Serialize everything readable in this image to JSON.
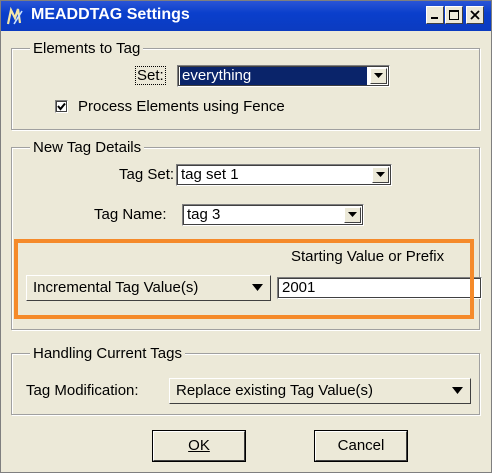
{
  "window": {
    "title": "MEADDTAG Settings",
    "controls": {
      "minimize": "_",
      "maximize": "□",
      "close": "×"
    }
  },
  "elements_to_tag": {
    "legend": "Elements to Tag",
    "set_label": "Set:",
    "set_value": "everything",
    "fence_checkbox_label": "Process Elements using Fence",
    "fence_checked": true
  },
  "new_tag_details": {
    "legend": "New Tag Details",
    "tag_set_label": "Tag Set:",
    "tag_set_value": "tag set 1",
    "tag_name_label": "Tag Name:",
    "tag_name_value": "tag 3",
    "starting_value_label": "Starting Value or Prefix",
    "mode_value": "Incremental Tag Value(s)",
    "starting_value": "2001"
  },
  "handling_current_tags": {
    "legend": "Handling Current Tags",
    "modification_label": "Tag Modification:",
    "modification_value": "Replace existing Tag Value(s)"
  },
  "buttons": {
    "ok": "OK",
    "cancel": "Cancel"
  },
  "colors": {
    "titlebar": "#0a3fcc",
    "dialog_bg": "#ece9d8",
    "selection": "#0a246a",
    "highlight_box": "#f58a2a"
  },
  "icons": {
    "app": "microstation-app-icon",
    "dropdown": "chevron-down-icon",
    "check": "check-icon"
  }
}
